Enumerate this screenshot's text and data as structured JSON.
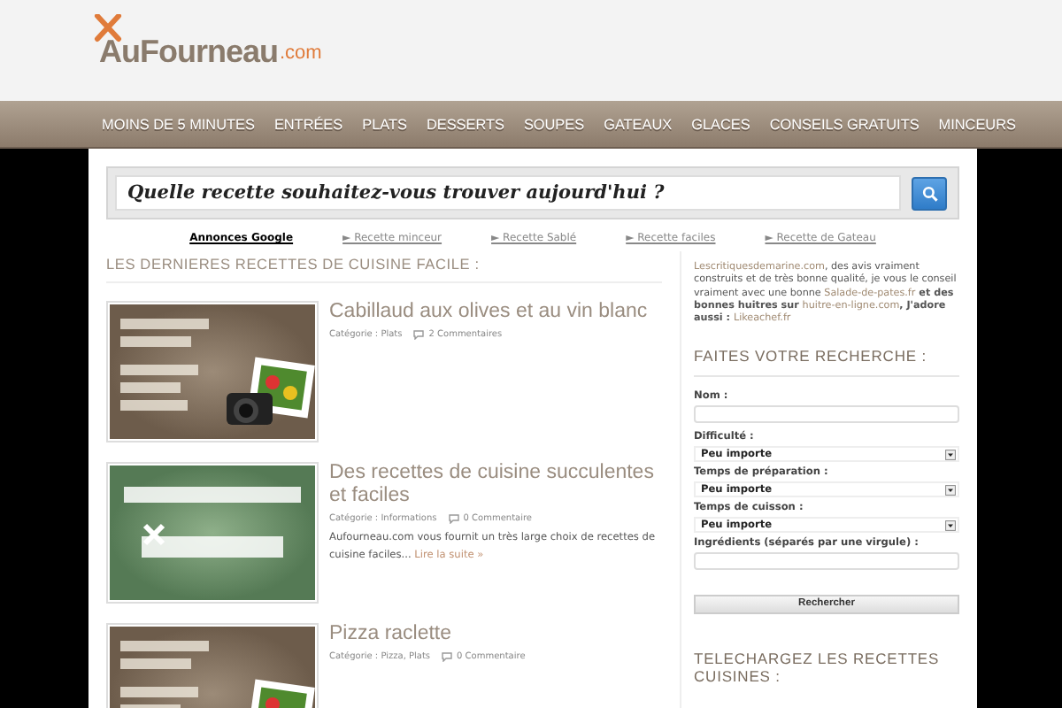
{
  "logo": {
    "brand": "AuFourneau",
    ".com": ".com"
  },
  "nav": {
    "items": [
      "MOINS DE 5 MINUTES",
      "ENTRÉES",
      "PLATS",
      "DESSERTS",
      "SOUPES",
      "GATEAUX",
      "GLACES",
      "CONSEILS GRATUITS",
      "MINCEURS"
    ]
  },
  "search": {
    "placeholder": "Quelle recette souhaitez-vous trouver aujourd'hui ?"
  },
  "ad_links": {
    "label": "Annonces Google",
    "links": [
      "► Recette minceur",
      "► Recette Sablé",
      "► Recette faciles",
      "► Recette de Gateau"
    ]
  },
  "posts_heading": "LES DERNIERES RECETTES DE CUISINE FACILE :",
  "posts": [
    {
      "title": "Cabillaud aux olives et au vin blanc",
      "category": "Catégorie : Plats",
      "comments": "2 Commentaires"
    },
    {
      "title": "Des recettes de cuisine succulentes et faciles",
      "category": "Catégorie : Informations",
      "comments": "0 Commentaire",
      "excerpt": "Aufourneau.com vous fournit un très large choix de recettes de cuisine faciles...",
      "more": "Lire la suite »"
    },
    {
      "title": "Pizza raclette",
      "category": "Catégorie : Pizza, Plats",
      "comments": "0 Commentaire"
    }
  ],
  "sidebar": {
    "blurb": [
      {
        "kind": "link",
        "text": "Lescritiquesdemarine.com"
      },
      {
        "kind": "plain",
        "text": ", des avis vraiment construits et de très bonne qualité, je vous le conseil vraiment avec une bonne "
      },
      {
        "kind": "link",
        "text": "Salade-de-pates.fr"
      },
      {
        "kind": "bold",
        "text": " et des bonnes huitres sur "
      },
      {
        "kind": "link",
        "text": "huitre-en-ligne.com"
      },
      {
        "kind": "bold",
        "text": ", J'adore aussi : "
      },
      {
        "kind": "link",
        "text": "Likeachef.fr"
      }
    ],
    "search_title": "FAITES VOTRE RECHERCHE :",
    "fields": [
      {
        "kind": "text",
        "label": "Nom :"
      },
      {
        "kind": "select",
        "label": "Difficulté :",
        "value": "Peu importe"
      },
      {
        "kind": "select",
        "label": "Temps de préparation :",
        "value": "Peu importe"
      },
      {
        "kind": "select",
        "label": "Temps de cuisson :",
        "value": "Peu importe"
      },
      {
        "kind": "text",
        "label": "Ingrédients (séparés par une virgule) :"
      },
      {
        "kind": "button",
        "label": "Rechercher"
      }
    ],
    "download_title": "TELECHARGEZ LES RECETTES CUISINES :"
  }
}
